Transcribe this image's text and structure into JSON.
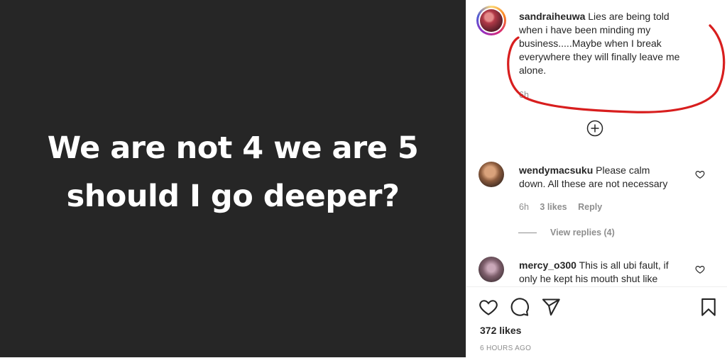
{
  "post": {
    "media_lines": [
      "We are not 4 we are 5",
      "should I go deeper?"
    ]
  },
  "caption": {
    "username": "sandraiheuwa",
    "text_lines": [
      "Lies are being told",
      "when i have been minding my",
      "business.....Maybe when I break",
      "everywhere they will finally leave me",
      "alone."
    ],
    "time": "6h"
  },
  "comments": [
    {
      "username": "wendymacsuku",
      "text_lines": [
        "Please calm",
        "down. All these are not necessary"
      ],
      "time": "6h",
      "likes": "3 likes",
      "reply": "Reply",
      "view_replies": "View replies (4)"
    },
    {
      "username": "mercy_o300",
      "text_lines": [
        "This is all ubi fault, if",
        "only he kept his mouth shut like"
      ]
    }
  ],
  "actions": {
    "likes": "372 likes",
    "timestamp": "6 HOURS AGO"
  },
  "colors": {
    "media_bg": "#262626",
    "annotation": "#d81e1e",
    "text": "#262626",
    "muted": "#8e8e8e"
  },
  "icons": [
    "plus-circle-icon",
    "heart-icon",
    "comment-icon",
    "share-icon",
    "bookmark-icon"
  ]
}
